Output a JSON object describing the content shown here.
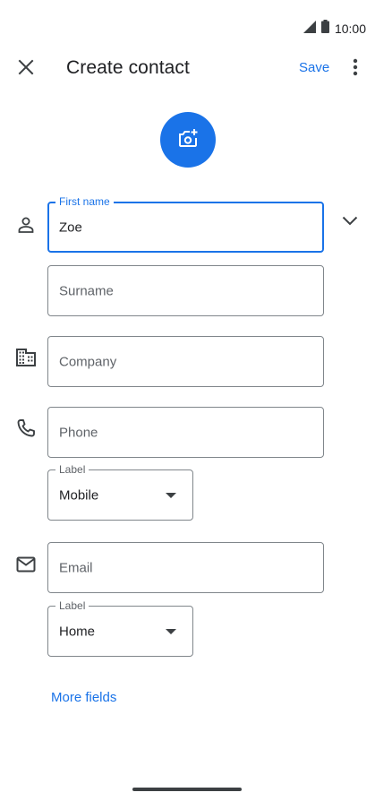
{
  "status_bar": {
    "time": "10:00",
    "icons": [
      "signal-icon",
      "battery-icon"
    ]
  },
  "app_bar": {
    "title": "Create contact",
    "save_label": "Save",
    "close_icon": "close-icon",
    "more_icon": "more-vert-icon"
  },
  "photo": {
    "icon": "add-photo-icon",
    "color": "#1a73e8"
  },
  "form": {
    "first_name": {
      "label": "First name",
      "value": "Zoe"
    },
    "surname": {
      "placeholder": "Surname"
    },
    "company": {
      "placeholder": "Company"
    },
    "phone": {
      "placeholder": "Phone",
      "label_caption": "Label",
      "label_value": "Mobile"
    },
    "email": {
      "placeholder": "Email",
      "label_caption": "Label",
      "label_value": "Home"
    }
  },
  "more_fields_label": "More fields",
  "colors": {
    "accent": "#1a73e8",
    "text": "#202124",
    "secondary": "#5f6368",
    "outline": "#80868b"
  }
}
